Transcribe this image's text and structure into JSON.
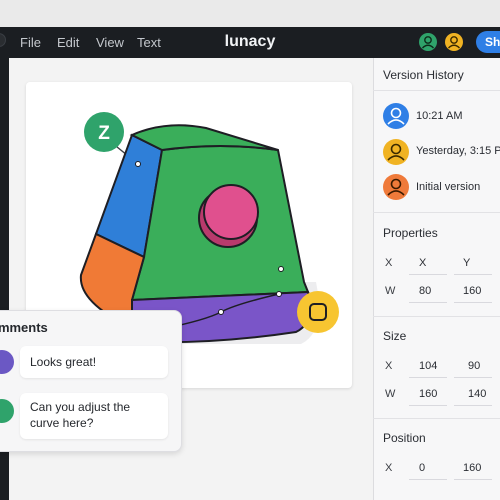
{
  "app": {
    "title": "lunacy"
  },
  "menu": [
    {
      "label": "File"
    },
    {
      "label": "Edit"
    },
    {
      "label": "View"
    },
    {
      "label": "Text"
    }
  ],
  "toolbar": {
    "share_label": "Sh"
  },
  "version_history": {
    "title": "Version History",
    "items": [
      {
        "label": "10:21 AM",
        "avatar_color": "#2f7fe6"
      },
      {
        "label": "Yesterday, 3:15 P",
        "avatar_color": "#f0b323"
      },
      {
        "label": "Initial version",
        "avatar_color": "#ef7a3a"
      }
    ]
  },
  "properties": {
    "title": "Properties",
    "rows": [
      {
        "label": "X",
        "v1": "X",
        "v2": "Y"
      },
      {
        "label": "W",
        "v1": "80",
        "v2": "160"
      }
    ]
  },
  "size": {
    "title": "Size",
    "rows": [
      {
        "label": "X",
        "v1": "104",
        "v2": "90"
      },
      {
        "label": "W",
        "v1": "160",
        "v2": "140"
      }
    ]
  },
  "position": {
    "title": "Position",
    "rows": [
      {
        "label": "X",
        "v1": "0",
        "v2": "160"
      }
    ]
  },
  "comments": {
    "title": "omments",
    "items": [
      {
        "text": "Looks great!",
        "avatar_color": "#6b58c4"
      },
      {
        "text": "Can you adjust the curve here?",
        "avatar_color": "#2fa36b"
      }
    ]
  },
  "canvas": {
    "pin_z_label": "Z",
    "colors": {
      "blue": "#2f7fd8",
      "green": "#3aae5a",
      "orange": "#f07a36",
      "purple": "#7a55c8",
      "pink": "#e0508e",
      "yellow": "#f7c531"
    }
  }
}
